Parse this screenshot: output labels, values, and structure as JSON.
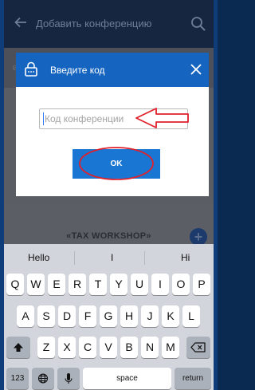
{
  "appbar": {
    "title": "Добавить конференцию"
  },
  "background": {
    "workshop_label": "«TAX WORKSHOP»",
    "add_symbol": "+"
  },
  "dialog": {
    "title": "Введите код",
    "input_placeholder": "Код конференции",
    "input_value": "",
    "ok_label": "OK"
  },
  "keyboard": {
    "suggestions": [
      "Hello",
      "I",
      "Hi"
    ],
    "row1": [
      "Q",
      "W",
      "E",
      "R",
      "T",
      "Y",
      "U",
      "I",
      "O",
      "P"
    ],
    "row2": [
      "A",
      "S",
      "D",
      "F",
      "G",
      "H",
      "J",
      "K",
      "L"
    ],
    "row3": [
      "Z",
      "X",
      "C",
      "V",
      "B",
      "N",
      "M"
    ],
    "numbers_label": "123",
    "space_label": "space",
    "return_label": "return"
  },
  "colors": {
    "dialog_header": "#1565c0",
    "ok_button": "#1976d2",
    "annotation": "#e0202a"
  }
}
